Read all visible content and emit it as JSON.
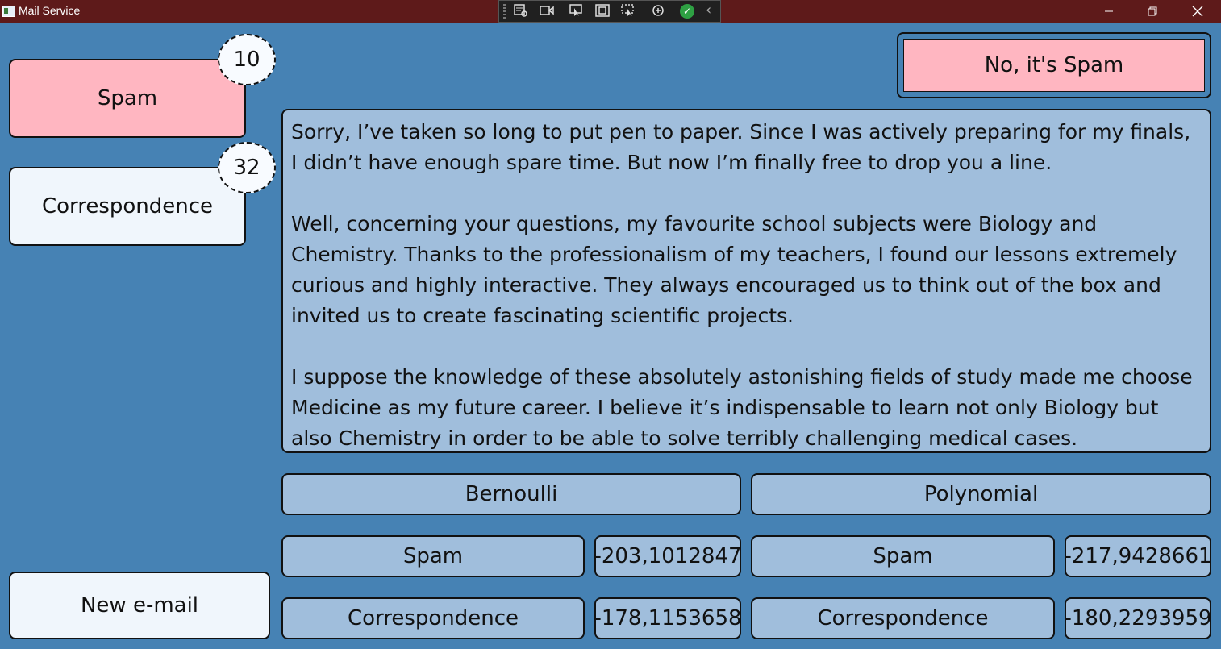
{
  "window": {
    "title": "Mail Service",
    "controls": [
      "minimize-icon",
      "restore-icon",
      "close-icon"
    ]
  },
  "debug_toolbar": {
    "icons": [
      "live-visual-tree-icon",
      "record-icon",
      "select-element-icon",
      "display-layout-adorners-icon",
      "track-focus-icon",
      "binding-failures-icon",
      "check-icon",
      "collapse-chevron-icon"
    ]
  },
  "folders": [
    {
      "label": "Spam",
      "count": "10",
      "color": "#ffb6c1"
    },
    {
      "label": "Correspondence",
      "count": "32",
      "color": "#f0f6fc"
    }
  ],
  "new_email_label": "New e-mail",
  "mark_button_label": "No, it's Spam",
  "email": {
    "paragraphs": [
      "Sorry, I’ve taken so long to put pen to paper. Since I was actively preparing for my finals, I didn’t have enough spare time. But now I’m finally free to drop you a line.",
      "Well, concerning your questions, my favourite school subjects were Biology and Chemistry. Thanks to the professionalism of my teachers, I found our lessons extremely curious and highly interactive. They always encouraged us to think out of the box and invited us to create fascinating scientific projects.",
      "I suppose the knowledge of these absolutely astonishing fields of study made me choose Medicine as my future career. I believe it’s indispensable to learn not only Biology but also Chemistry in order to be able to solve terribly challenging medical cases."
    ]
  },
  "classifiers": {
    "bernoulli": {
      "title": "Bernoulli",
      "rows": [
        {
          "label": "Spam",
          "value": "-203,1012847"
        },
        {
          "label": "Correspondence",
          "value": "-178,1153658"
        }
      ]
    },
    "polynomial": {
      "title": "Polynomial",
      "rows": [
        {
          "label": "Spam",
          "value": "-217,9428661"
        },
        {
          "label": "Correspondence",
          "value": "-180,2293959"
        }
      ]
    }
  },
  "colors": {
    "background": "#4682b4",
    "titlebar": "#5e1a1a",
    "spam": "#ffb6c1",
    "panel": "#a0bedc"
  }
}
